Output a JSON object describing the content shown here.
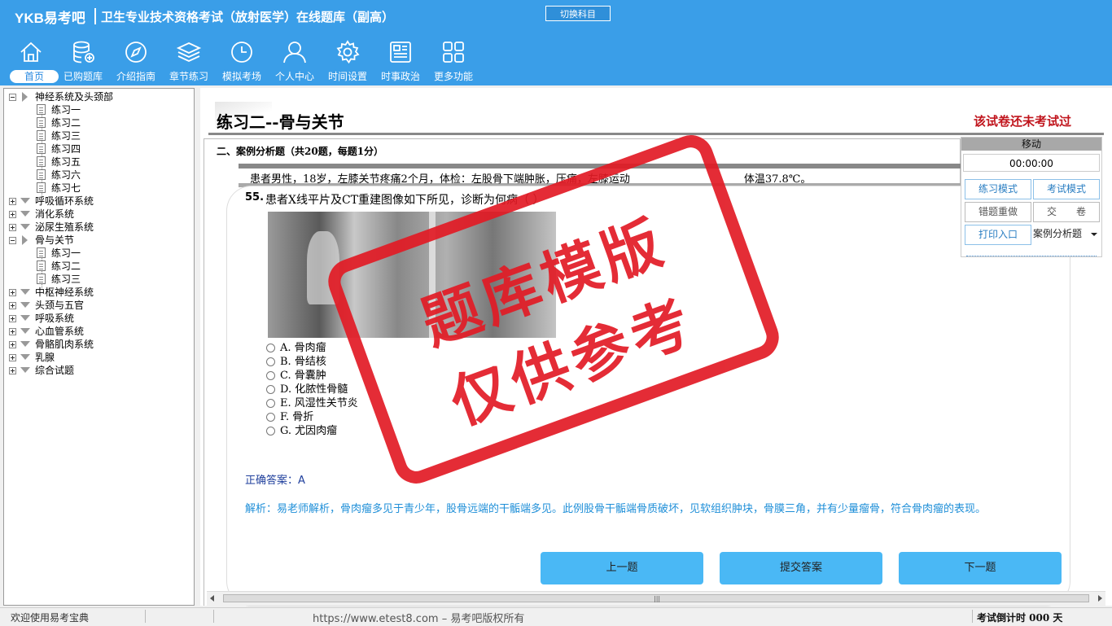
{
  "header": {
    "brand": "YKB易考吧",
    "title": "卫生专业技术资格考试（放射医学）在线题库（副高）",
    "switch_label": "切换科目"
  },
  "nav": [
    {
      "label": "首页",
      "icon": "home-icon",
      "active": true
    },
    {
      "label": "已购题库",
      "icon": "database-add-icon"
    },
    {
      "label": "介绍指南",
      "icon": "compass-icon"
    },
    {
      "label": "章节练习",
      "icon": "layers-icon"
    },
    {
      "label": "模拟考场",
      "icon": "clock-icon"
    },
    {
      "label": "个人中心",
      "icon": "user-icon"
    },
    {
      "label": "时间设置",
      "icon": "gear-icon"
    },
    {
      "label": "时事政治",
      "icon": "news-icon"
    },
    {
      "label": "更多功能",
      "icon": "grid-icon"
    }
  ],
  "tree": [
    {
      "label": "神经系统及头颈部",
      "open": true,
      "children": [
        "练习一",
        "练习二",
        "练习三",
        "练习四",
        "练习五",
        "练习六",
        "练习七"
      ]
    },
    {
      "label": "呼吸循环系统",
      "open": false
    },
    {
      "label": "消化系统",
      "open": false
    },
    {
      "label": "泌尿生殖系统",
      "open": false
    },
    {
      "label": "骨与关节",
      "open": true,
      "children": [
        "练习一",
        "练习二",
        "练习三"
      ]
    },
    {
      "label": "中枢神经系统",
      "open": false
    },
    {
      "label": "头颈与五官",
      "open": false
    },
    {
      "label": "呼吸系统",
      "open": false
    },
    {
      "label": "心血管系统",
      "open": false
    },
    {
      "label": "骨骼肌肉系统",
      "open": false
    },
    {
      "label": "乳腺",
      "open": false
    },
    {
      "label": "综合试题",
      "open": false
    }
  ],
  "exam": {
    "title": "练习二--骨与关节",
    "status": "该试卷还未考试过",
    "section": "二、案例分析题（共20题，每题1分）",
    "case_text": "患者男性，18岁，左膝关节疼痛2个月，体检：左股骨下端肿胀，压痛，左膝运动",
    "case_tail": "体温37.8℃。"
  },
  "question": {
    "number": "55.",
    "text": "患者X线平片及CT重建图像如下所见，诊断为何病（ ）",
    "options": [
      "A. 骨肉瘤",
      "B. 骨结核",
      "C. 骨囊肿",
      "D. 化脓性骨髓",
      "E. 风湿性关节炎",
      "F. 骨折",
      "G. 尤因肉瘤"
    ],
    "answer_label": "正确答案：",
    "answer_value": "A",
    "analysis": "解析：易老师解析，骨肉瘤多见于青少年，股骨远端的干骺端多见。此例股骨干骺端骨质破坏，见软组织肿块，骨膜三角，并有少量瘤骨，符合骨肉瘤的表现。"
  },
  "buttons": {
    "prev": "上一题",
    "submit": "提交答案",
    "next": "下一题"
  },
  "right_panel": {
    "header": "移动",
    "timer": "00:00:00",
    "practice_mode": "练习模式",
    "exam_mode": "考试模式",
    "redo_wrong": "错题重做",
    "hand_in": "交　　卷",
    "print": "打印入口",
    "type_select": "案例分析题"
  },
  "stamp": {
    "line1": "题库模版",
    "line2": "仅供参考"
  },
  "status": {
    "welcome": "欢迎使用易考宝典",
    "url": "https://www.etest8.com – 易考吧版权所有",
    "countdown": "考试倒计时 000 天"
  },
  "colors": {
    "header_bg": "#3a9ee8",
    "status_red": "#c0141c",
    "answer_blue": "#1f3f9c",
    "analysis_blue": "#1f8fd8",
    "button_blue": "#4ab8f5"
  }
}
